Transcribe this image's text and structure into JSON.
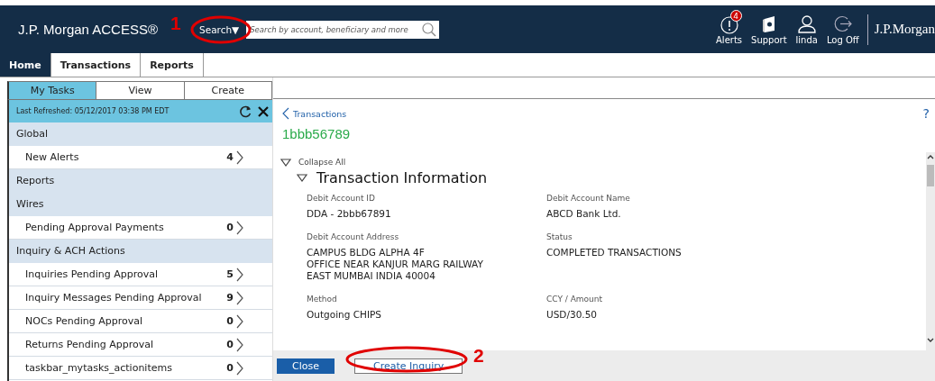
{
  "header": {
    "logo": "J.P. Morgan ACCESS®",
    "search_button": "Search▼",
    "search_field": {
      "placeholder": "Search by account, beneficiary and more"
    },
    "actions": [
      {
        "kind": "alerts",
        "label": "Alerts",
        "badge": "4"
      },
      {
        "kind": "support",
        "label": "Support"
      },
      {
        "kind": "user",
        "label": "linda"
      },
      {
        "kind": "logoff",
        "label": "Log Off"
      }
    ],
    "brand": "J.P.Morgan"
  },
  "nav_tabs": [
    {
      "label": "Home",
      "selected": true
    },
    {
      "label": "Transactions",
      "selected": false
    },
    {
      "label": "Reports",
      "selected": false
    }
  ],
  "sidebar": {
    "tabs": [
      {
        "label": "My Tasks",
        "selected": true
      },
      {
        "label": "View",
        "selected": false
      },
      {
        "label": "Create",
        "selected": false
      }
    ],
    "refreshed": "Last Refreshed: 05/12/2017 03:38 PM EDT",
    "items": [
      {
        "kind": "group",
        "label": "Global"
      },
      {
        "kind": "task",
        "label": "New Alerts",
        "count": "4"
      },
      {
        "kind": "group",
        "label": "Reports"
      },
      {
        "kind": "group",
        "label": "Wires"
      },
      {
        "kind": "task",
        "label": "Pending Approval Payments",
        "count": "0"
      },
      {
        "kind": "group",
        "label": "Inquiry & ACH Actions"
      },
      {
        "kind": "task",
        "label": "Inquiries Pending Approval",
        "count": "5"
      },
      {
        "kind": "task",
        "label": "Inquiry Messages Pending Approval",
        "count": "9"
      },
      {
        "kind": "task",
        "label": "NOCs Pending Approval",
        "count": "0"
      },
      {
        "kind": "task",
        "label": "Returns Pending Approval",
        "count": "0"
      },
      {
        "kind": "task",
        "label": "taskbar_mytasks_actionitems",
        "count": "0"
      }
    ]
  },
  "detail": {
    "breadcrumb": "Transactions",
    "help": "?",
    "title": "1bbb56789",
    "collapse_all": "Collapse All",
    "section": {
      "title": "Transaction Information",
      "expanded": true,
      "fields": [
        {
          "label": "Debit Account ID",
          "lines": [
            "DDA - 2bbb67891"
          ]
        },
        {
          "label": "Debit Account Name",
          "lines": [
            "ABCD Bank Ltd."
          ]
        },
        {
          "label": "Debit Account Address",
          "lines": [
            "CAMPUS BLDG ALPHA 4F",
            "OFFICE NEAR KANJUR MARG RAILWAY",
            "EAST MUMBAI INDIA 40004"
          ]
        },
        {
          "label": "Status",
          "lines": [
            "COMPLETED TRANSACTIONS"
          ]
        },
        {
          "label": "Method",
          "lines": [
            "Outgoing CHIPS"
          ]
        },
        {
          "label": "CCY / Amount",
          "lines": [
            "USD/30.50"
          ]
        }
      ]
    },
    "buttons": [
      {
        "kind": "primary",
        "label": "Close"
      },
      {
        "kind": "secondary",
        "label": "Create Inquiry"
      }
    ]
  },
  "annotations": [
    {
      "kind": "search",
      "label": "1"
    },
    {
      "kind": "footer",
      "label": "2"
    }
  ]
}
